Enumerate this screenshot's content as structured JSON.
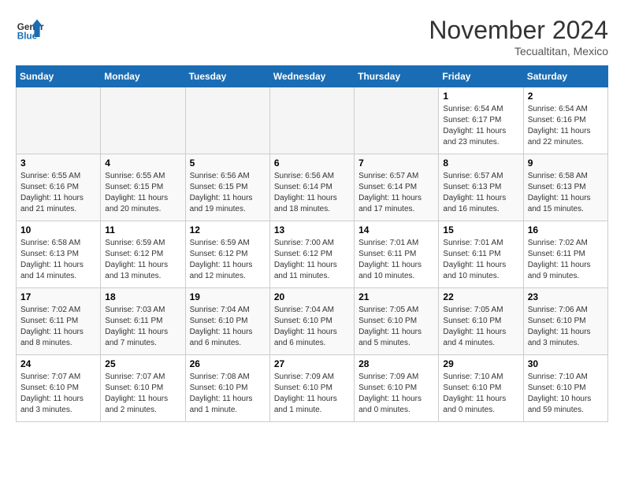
{
  "header": {
    "logo_line1": "General",
    "logo_line2": "Blue",
    "month_title": "November 2024",
    "subtitle": "Tecualtitan, Mexico"
  },
  "weekdays": [
    "Sunday",
    "Monday",
    "Tuesday",
    "Wednesday",
    "Thursday",
    "Friday",
    "Saturday"
  ],
  "weeks": [
    [
      {
        "day": "",
        "info": ""
      },
      {
        "day": "",
        "info": ""
      },
      {
        "day": "",
        "info": ""
      },
      {
        "day": "",
        "info": ""
      },
      {
        "day": "",
        "info": ""
      },
      {
        "day": "1",
        "info": "Sunrise: 6:54 AM\nSunset: 6:17 PM\nDaylight: 11 hours and 23 minutes."
      },
      {
        "day": "2",
        "info": "Sunrise: 6:54 AM\nSunset: 6:16 PM\nDaylight: 11 hours and 22 minutes."
      }
    ],
    [
      {
        "day": "3",
        "info": "Sunrise: 6:55 AM\nSunset: 6:16 PM\nDaylight: 11 hours and 21 minutes."
      },
      {
        "day": "4",
        "info": "Sunrise: 6:55 AM\nSunset: 6:15 PM\nDaylight: 11 hours and 20 minutes."
      },
      {
        "day": "5",
        "info": "Sunrise: 6:56 AM\nSunset: 6:15 PM\nDaylight: 11 hours and 19 minutes."
      },
      {
        "day": "6",
        "info": "Sunrise: 6:56 AM\nSunset: 6:14 PM\nDaylight: 11 hours and 18 minutes."
      },
      {
        "day": "7",
        "info": "Sunrise: 6:57 AM\nSunset: 6:14 PM\nDaylight: 11 hours and 17 minutes."
      },
      {
        "day": "8",
        "info": "Sunrise: 6:57 AM\nSunset: 6:13 PM\nDaylight: 11 hours and 16 minutes."
      },
      {
        "day": "9",
        "info": "Sunrise: 6:58 AM\nSunset: 6:13 PM\nDaylight: 11 hours and 15 minutes."
      }
    ],
    [
      {
        "day": "10",
        "info": "Sunrise: 6:58 AM\nSunset: 6:13 PM\nDaylight: 11 hours and 14 minutes."
      },
      {
        "day": "11",
        "info": "Sunrise: 6:59 AM\nSunset: 6:12 PM\nDaylight: 11 hours and 13 minutes."
      },
      {
        "day": "12",
        "info": "Sunrise: 6:59 AM\nSunset: 6:12 PM\nDaylight: 11 hours and 12 minutes."
      },
      {
        "day": "13",
        "info": "Sunrise: 7:00 AM\nSunset: 6:12 PM\nDaylight: 11 hours and 11 minutes."
      },
      {
        "day": "14",
        "info": "Sunrise: 7:01 AM\nSunset: 6:11 PM\nDaylight: 11 hours and 10 minutes."
      },
      {
        "day": "15",
        "info": "Sunrise: 7:01 AM\nSunset: 6:11 PM\nDaylight: 11 hours and 10 minutes."
      },
      {
        "day": "16",
        "info": "Sunrise: 7:02 AM\nSunset: 6:11 PM\nDaylight: 11 hours and 9 minutes."
      }
    ],
    [
      {
        "day": "17",
        "info": "Sunrise: 7:02 AM\nSunset: 6:11 PM\nDaylight: 11 hours and 8 minutes."
      },
      {
        "day": "18",
        "info": "Sunrise: 7:03 AM\nSunset: 6:11 PM\nDaylight: 11 hours and 7 minutes."
      },
      {
        "day": "19",
        "info": "Sunrise: 7:04 AM\nSunset: 6:10 PM\nDaylight: 11 hours and 6 minutes."
      },
      {
        "day": "20",
        "info": "Sunrise: 7:04 AM\nSunset: 6:10 PM\nDaylight: 11 hours and 6 minutes."
      },
      {
        "day": "21",
        "info": "Sunrise: 7:05 AM\nSunset: 6:10 PM\nDaylight: 11 hours and 5 minutes."
      },
      {
        "day": "22",
        "info": "Sunrise: 7:05 AM\nSunset: 6:10 PM\nDaylight: 11 hours and 4 minutes."
      },
      {
        "day": "23",
        "info": "Sunrise: 7:06 AM\nSunset: 6:10 PM\nDaylight: 11 hours and 3 minutes."
      }
    ],
    [
      {
        "day": "24",
        "info": "Sunrise: 7:07 AM\nSunset: 6:10 PM\nDaylight: 11 hours and 3 minutes."
      },
      {
        "day": "25",
        "info": "Sunrise: 7:07 AM\nSunset: 6:10 PM\nDaylight: 11 hours and 2 minutes."
      },
      {
        "day": "26",
        "info": "Sunrise: 7:08 AM\nSunset: 6:10 PM\nDaylight: 11 hours and 1 minute."
      },
      {
        "day": "27",
        "info": "Sunrise: 7:09 AM\nSunset: 6:10 PM\nDaylight: 11 hours and 1 minute."
      },
      {
        "day": "28",
        "info": "Sunrise: 7:09 AM\nSunset: 6:10 PM\nDaylight: 11 hours and 0 minutes."
      },
      {
        "day": "29",
        "info": "Sunrise: 7:10 AM\nSunset: 6:10 PM\nDaylight: 11 hours and 0 minutes."
      },
      {
        "day": "30",
        "info": "Sunrise: 7:10 AM\nSunset: 6:10 PM\nDaylight: 10 hours and 59 minutes."
      }
    ]
  ]
}
